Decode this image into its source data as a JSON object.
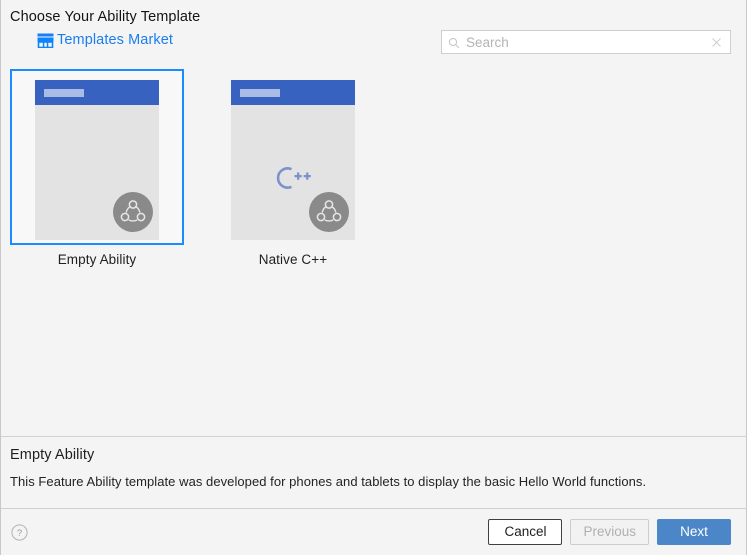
{
  "dialog": {
    "title": "Choose Your Ability Template"
  },
  "toolbar": {
    "templates_market_label": "Templates Market",
    "templates_market_icon": "shop-icon",
    "accent_color": "#1a7ef0"
  },
  "search": {
    "placeholder": "Search",
    "value": "",
    "search_icon": "search-icon",
    "clear_icon": "close-icon"
  },
  "templates": [
    {
      "label": "Empty Ability",
      "selected": true,
      "has_cpp_logo": false,
      "badge_icon": "harmonyos-badge-icon",
      "titlebar_color": "#3762c0",
      "body_color": "#e3e3e3"
    },
    {
      "label": "Native C++",
      "selected": false,
      "has_cpp_logo": true,
      "cpp_logo_text": "C++",
      "badge_icon": "harmonyos-badge-icon",
      "titlebar_color": "#3762c0",
      "body_color": "#e3e3e3"
    }
  ],
  "description": {
    "title": "Empty Ability",
    "text": "This Feature Ability template was developed for phones and tablets to display the basic Hello World functions."
  },
  "footer": {
    "help_icon": "help-icon",
    "cancel_label": "Cancel",
    "previous_label": "Previous",
    "next_label": "Next",
    "primary_color": "#4a86c8"
  }
}
